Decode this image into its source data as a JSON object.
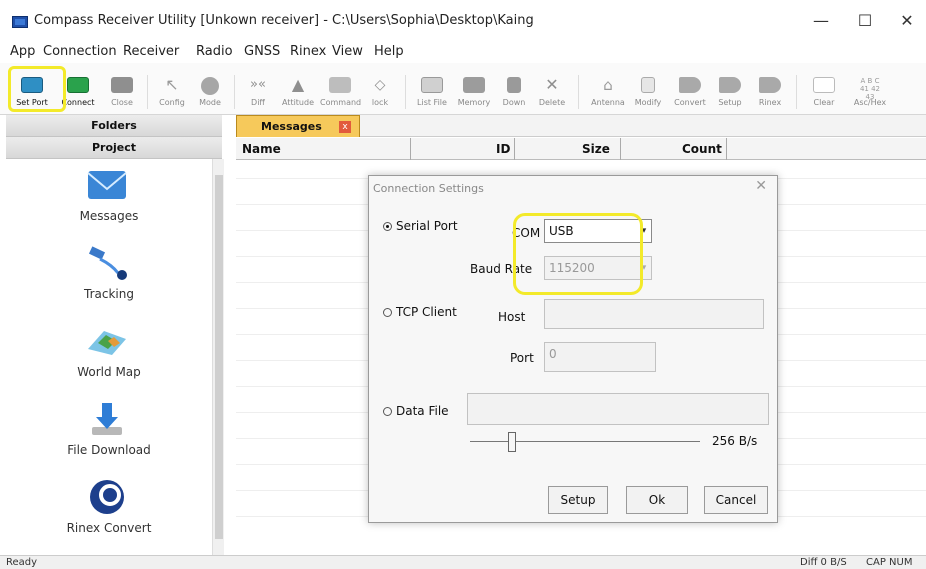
{
  "window": {
    "title": "Compass Receiver Utility [Unkown receiver] - C:\\Users\\Sophia\\Desktop\\Kaing",
    "minimize": "—",
    "maximize": "☐",
    "close": "✕"
  },
  "menu": [
    "App",
    "Connection",
    "Receiver",
    "Radio",
    "GNSS",
    "Rinex",
    "View",
    "Help"
  ],
  "toolbar": [
    {
      "label": "Set Port",
      "icon": "serial-port-icon",
      "color": "#2f8fc4"
    },
    {
      "label": "Connect",
      "icon": "connect-icon",
      "color": "#2aa24c"
    },
    {
      "label": "Close",
      "icon": "close-connection-icon",
      "color": "#8f8f8f"
    },
    {
      "label": "Config",
      "icon": "config-wrench-icon",
      "color": "#9a9a9a"
    },
    {
      "label": "Mode",
      "icon": "mode-icon",
      "color": "#a6a6a6"
    },
    {
      "label": "Diff",
      "icon": "diff-icon",
      "color": "#8f8f8f"
    },
    {
      "label": "Attitude",
      "icon": "attitude-icon",
      "color": "#8f8f8f"
    },
    {
      "label": "Command",
      "icon": "command-icon",
      "color": "#9c9c9c"
    },
    {
      "label": "lock",
      "icon": "lock-icon",
      "color": "#8f8f8f"
    },
    {
      "label": "List File",
      "icon": "list-file-icon",
      "color": "#9a9a9a"
    },
    {
      "label": "Memory",
      "icon": "memory-icon",
      "color": "#8c8c8c"
    },
    {
      "label": "Down",
      "icon": "download-icon",
      "color": "#8c8c8c"
    },
    {
      "label": "Delete",
      "icon": "delete-icon",
      "color": "#8c8c8c"
    },
    {
      "label": "Antenna",
      "icon": "antenna-icon",
      "color": "#9a9a9a"
    },
    {
      "label": "Modify",
      "icon": "modify-icon",
      "color": "#9a9a9a"
    },
    {
      "label": "Convert",
      "icon": "rinex-convert-icon",
      "color": "#a0a0a0"
    },
    {
      "label": "Setup",
      "icon": "rinex-setup-icon",
      "color": "#a0a0a0"
    },
    {
      "label": "Rinex",
      "icon": "rinex-icon",
      "color": "#a0a0a0"
    },
    {
      "label": "Clear",
      "icon": "clear-icon",
      "color": "#b5b5b5"
    },
    {
      "label": "Asc/Hex",
      "icon": "ascii-hex-icon",
      "color": "#9a9a9a"
    }
  ],
  "left_panel": {
    "folders": "Folders",
    "project": "Project",
    "items": [
      {
        "label": "Messages",
        "icon": "envelope-icon"
      },
      {
        "label": "Tracking",
        "icon": "satellite-tracking-icon"
      },
      {
        "label": "World Map",
        "icon": "world-map-icon"
      },
      {
        "label": "File Download",
        "icon": "file-download-icon"
      },
      {
        "label": "Rinex Convert",
        "icon": "rinex-convert-icon"
      }
    ]
  },
  "tabs": [
    {
      "label": "Messages",
      "close": "x"
    }
  ],
  "table": {
    "columns": [
      "Name",
      "ID",
      "Size",
      "Count"
    ]
  },
  "dialog": {
    "title": "Connection Settings",
    "close": "✕",
    "serial_port": "Serial Port",
    "com_label": "COM",
    "com_value": "USB",
    "baud_label": "Baud Rate",
    "baud_value": "115200",
    "tcp_client": "TCP Client",
    "host_label": "Host",
    "host_value": "",
    "port_label": "Port",
    "port_value": "0",
    "data_file": "Data File",
    "data_file_value": "",
    "rate": "256 B/s",
    "setup": "Setup",
    "ok": "Ok",
    "cancel": "Cancel"
  },
  "status": {
    "left": "Ready",
    "diff": "Diff 0 B/S",
    "caps": "CAP NUM"
  }
}
